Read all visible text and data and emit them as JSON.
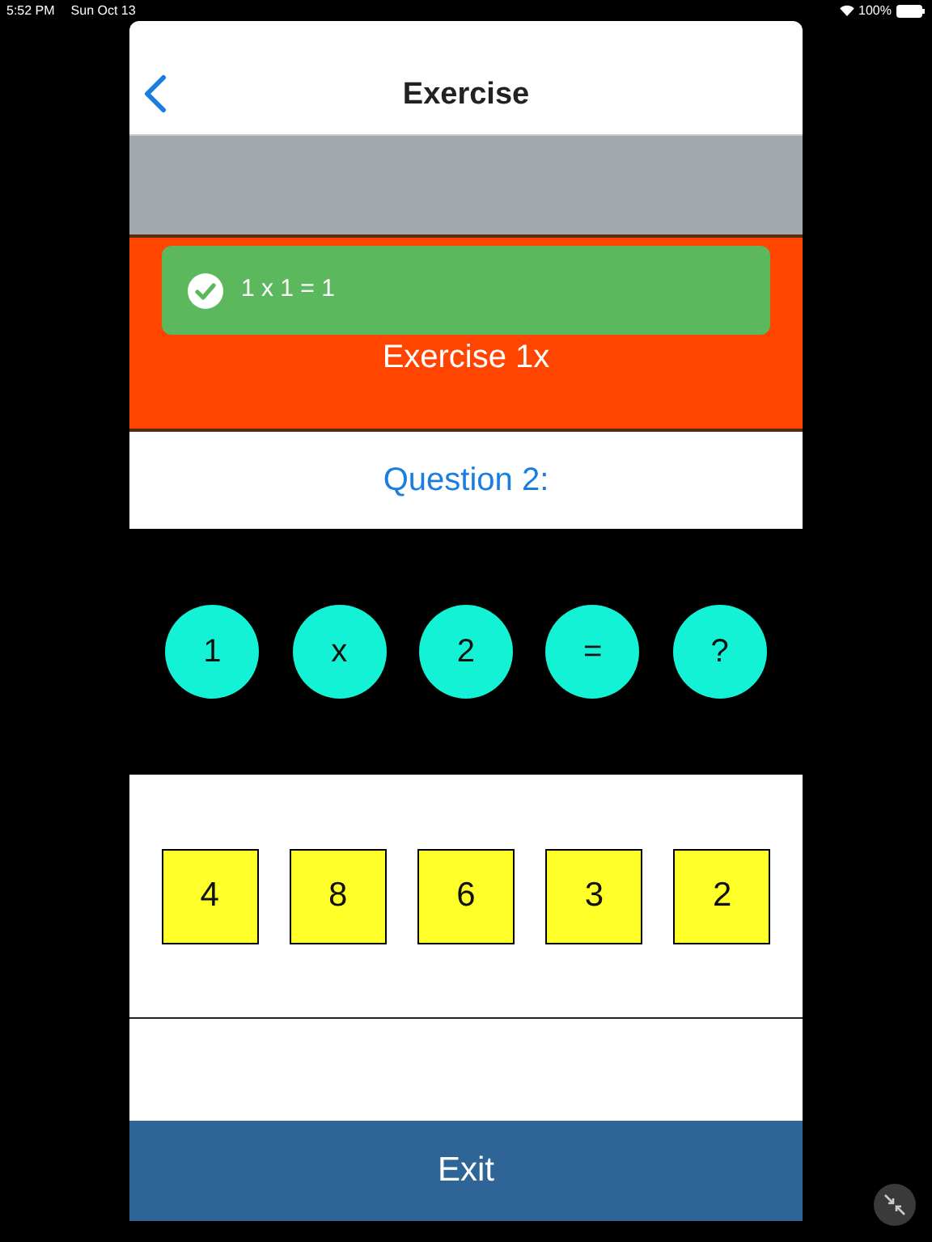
{
  "status_bar": {
    "time": "5:52 PM",
    "date": "Sun Oct 13",
    "battery": "100%"
  },
  "nav": {
    "title": "Exercise"
  },
  "banner": {
    "title": "Exercise 1x"
  },
  "toast": {
    "kind": "success",
    "message": "1 x 1 = 1"
  },
  "question": {
    "label": "Question 2:"
  },
  "equation": [
    "1",
    "x",
    "2",
    "=",
    "?"
  ],
  "answers": [
    {
      "label": "4"
    },
    {
      "label": "8"
    },
    {
      "label": "6"
    },
    {
      "label": "3"
    },
    {
      "label": "2"
    }
  ],
  "exit_button": "Exit"
}
